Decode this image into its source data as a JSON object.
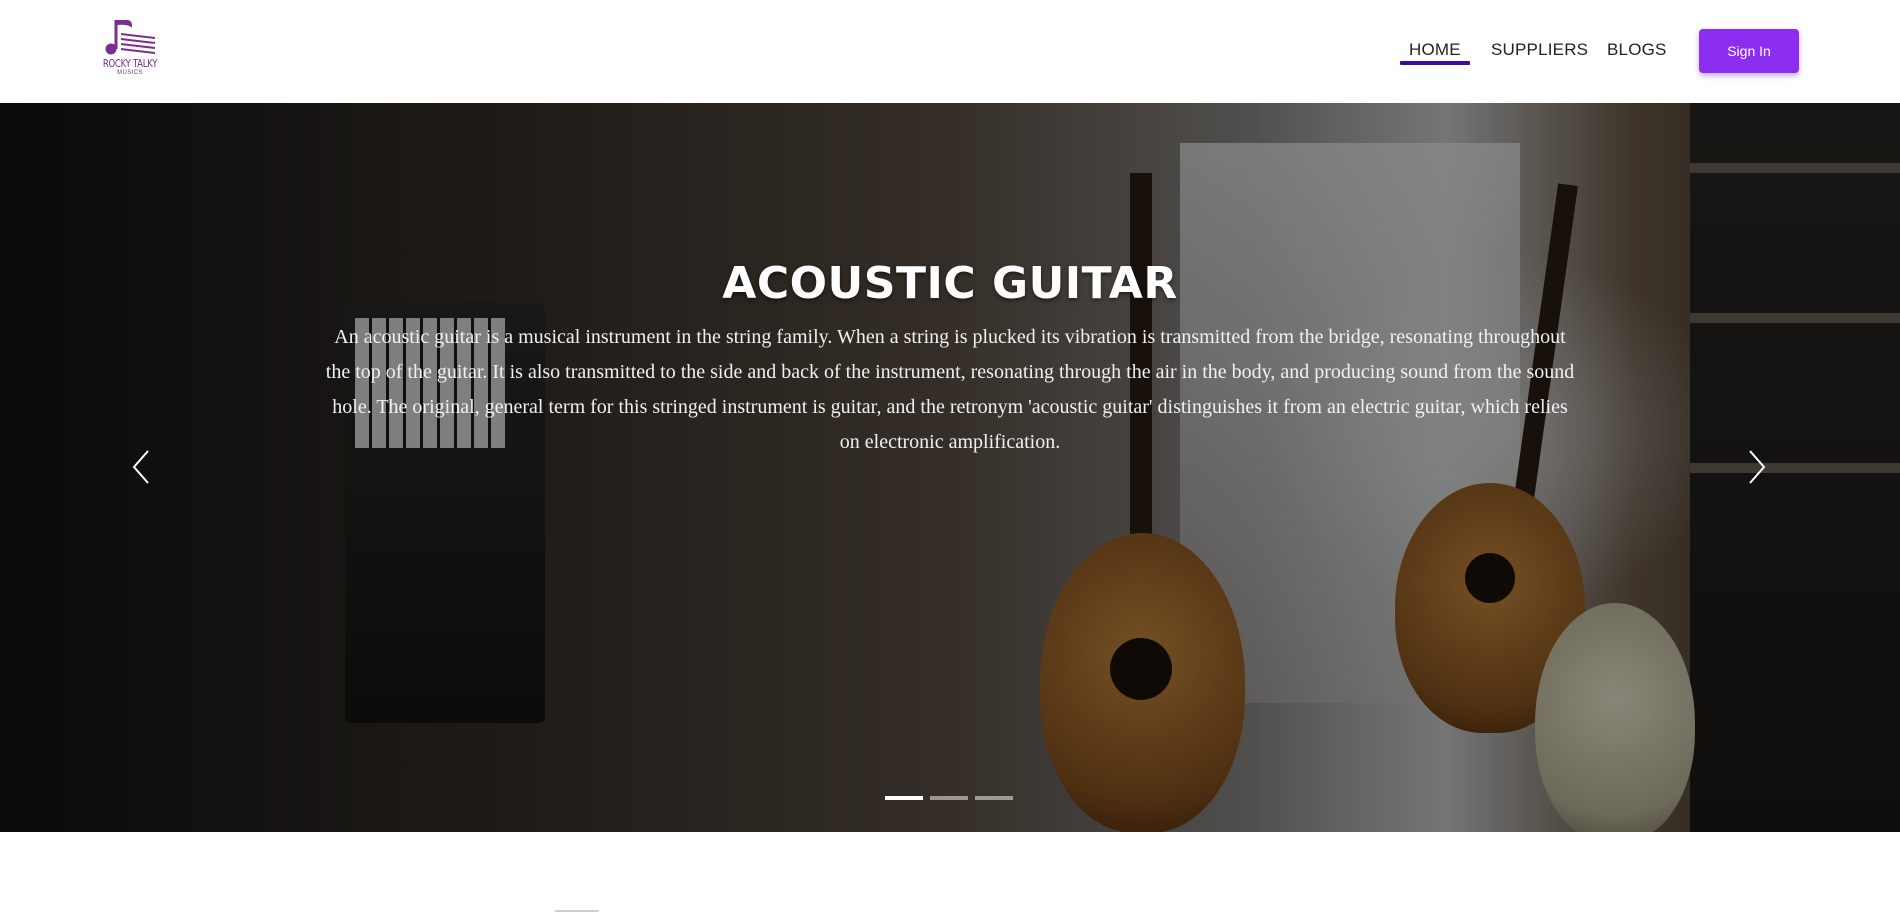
{
  "brand": {
    "name": "ROCKY TALKY",
    "tagline": "MUSICS",
    "color": "#7b2d91"
  },
  "nav": {
    "links": [
      {
        "label": "HOME",
        "active": true
      },
      {
        "label": "SUPPLIERS",
        "active": false
      },
      {
        "label": "BLOGS",
        "active": false
      }
    ],
    "active_underline_color": "#3a0ca3",
    "signin_label": "Sign In",
    "signin_color": "#8c2ef0"
  },
  "hero": {
    "title": "ACOUSTIC GUITAR",
    "description": "An acoustic guitar is a musical instrument in the string family. When a string is plucked its vibration is transmitted from the bridge, resonating throughout the top of the guitar. It is also transmitted to the side and back of the instrument, resonating through the air in the body, and producing sound from the sound hole. The original, general term for this stringed instrument is guitar, and the retronym 'acoustic guitar' distinguishes it from an electric guitar, which relies on electronic amplification.",
    "prev_icon": "chevron-left-icon",
    "next_icon": "chevron-right-icon",
    "slide_count": 3,
    "active_slide": 1
  }
}
